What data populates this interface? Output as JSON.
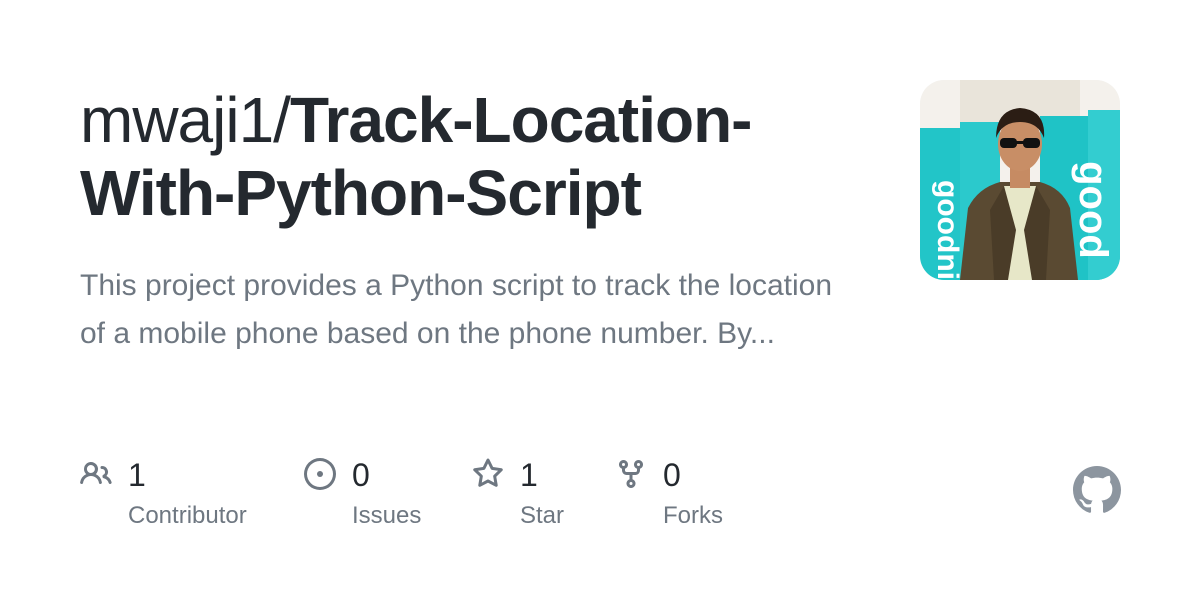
{
  "repo": {
    "owner": "mwaji1/",
    "name": "Track-Location-With-Python-Script",
    "description": "This project provides a Python script to track the location of a mobile phone based on the phone number. By..."
  },
  "stats": [
    {
      "count": "1",
      "label": "Contributor",
      "icon": "people-icon"
    },
    {
      "count": "0",
      "label": "Issues",
      "icon": "issue-opened-icon"
    },
    {
      "count": "1",
      "label": "Star",
      "icon": "star-icon"
    },
    {
      "count": "0",
      "label": "Forks",
      "icon": "repo-forked-icon"
    }
  ],
  "colors": {
    "title": "#24292f",
    "muted": "#6e7781",
    "github_logo": "#8c959f",
    "avatar_banner": "#1cc6c9"
  },
  "avatar": {
    "description_icon": "owner-avatar-photo"
  },
  "brand": {
    "icon": "github-mark-icon"
  }
}
